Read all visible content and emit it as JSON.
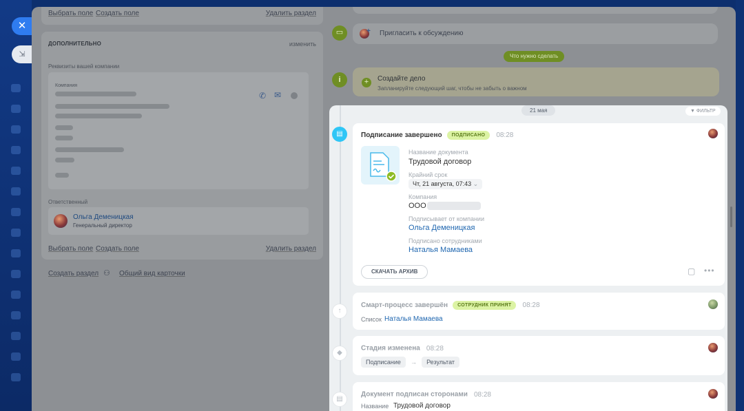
{
  "left_card_top": {
    "select_field": "Выбрать поле",
    "create_field": "Создать поле",
    "delete_section": "Удалить раздел"
  },
  "additional": {
    "header": "ДОПОЛНИТЕЛЬНО",
    "edit": "изменить",
    "requisites_label": "Реквизиты вашей компании",
    "company_label": "Компания",
    "responsible_label": "Ответственный",
    "person_name": "Ольга Деменицкая",
    "person_role": "Генеральный директор",
    "select_field": "Выбрать поле",
    "create_field": "Создать поле",
    "delete_section": "Удалить раздел"
  },
  "bottom_links": {
    "create_section": "Создать раздел",
    "card_view": "Общий вид карточки"
  },
  "right_top": {
    "invite": "Пригласить к обсуждению",
    "todo_pill": "Что нужно сделать",
    "create_task_title": "Создайте дело",
    "create_task_sub": "Запланируйте следующий шаг, чтобы не забыть о важном"
  },
  "timeline": {
    "date": "21 мая",
    "filter": "ФИЛЬТР",
    "card1": {
      "title": "Подписание завершено",
      "badge": "ПОДПИСАНО",
      "time": "08:28",
      "doc_name_label": "Название документа",
      "doc_name": "Трудовой договор",
      "deadline_label": "Крайний срок",
      "deadline": "Чт, 21 августа, 07:43",
      "company_label": "Компания",
      "company_value": "ООО",
      "signed_by_company_label": "Подписывает от компании",
      "signed_by_company": "Ольга Деменицкая",
      "signed_by_staff_label": "Подписано сотрудниками",
      "signed_by_staff": "Наталья Мамаева",
      "download_btn": "СКАЧАТЬ АРХИВ"
    },
    "card2": {
      "title": "Смарт-процесс завершён",
      "badge": "СОТРУДНИК ПРИНЯТ",
      "time": "08:28",
      "list_label": "Список",
      "list_value": "Наталья Мамаева"
    },
    "card3": {
      "title": "Стадия изменена",
      "time": "08:28",
      "from": "Подписание",
      "arrow": "→",
      "to": "Результат"
    },
    "card4": {
      "title": "Документ подписан сторонами",
      "time": "08:28",
      "name_label": "Название",
      "name_value": "Трудовой договор"
    }
  },
  "colors": {
    "accent_blue": "#2fc6f6",
    "badge_green": "#dcf3a4",
    "link_blue": "#2067b0",
    "green_icon": "#8dbb25"
  },
  "icons": [
    "close-icon",
    "pin-icon",
    "phone-icon",
    "mail-icon",
    "chat-icon",
    "document-icon",
    "filter-icon",
    "arrow-up-icon",
    "tag-icon",
    "more-icon",
    "note-icon"
  ]
}
